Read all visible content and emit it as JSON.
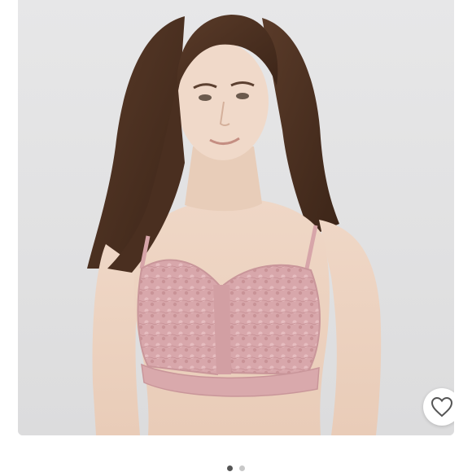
{
  "listing": {
    "photo": {
      "alt": "",
      "background_color": "#e4e4e5",
      "garment_color": "#d9a9ac"
    },
    "like_button": {
      "icon": "heart-outline-icon",
      "liked": false
    },
    "gallery": {
      "current_index": 1,
      "total": 2
    }
  }
}
